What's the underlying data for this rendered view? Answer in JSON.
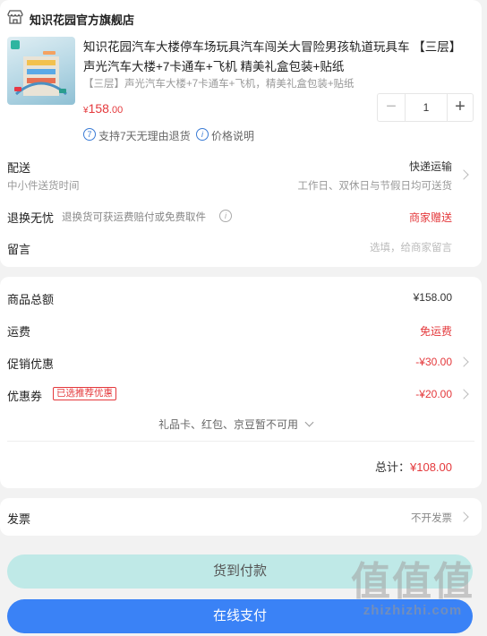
{
  "store": {
    "name": "知识花园官方旗舰店"
  },
  "product": {
    "title": "知识花园汽车大楼停车场玩具汽车闯关大冒险男孩轨道玩具车 【三层】声光汽车大楼+7卡通车+飞机 精美礼盒包装+贴纸",
    "sku": "【三层】声光汽车大楼+7卡通车+飞机，精美礼盒包装+贴纸",
    "price_symbol": "¥",
    "price_int": "158",
    "price_dec": ".00",
    "quantity": "1",
    "minus": "−",
    "plus": "+",
    "support_icon": "7",
    "support_text": "支持7天无理由退货",
    "info_icon": "i",
    "price_note": "价格说明"
  },
  "delivery": {
    "label": "配送",
    "sub": "中小件送货时间",
    "method": "快递运输",
    "time": "工作日、双休日与节假日均可送货"
  },
  "returns": {
    "label": "退换无忧",
    "desc": "退换货可获运费赔付或免费取件",
    "info_icon": "i",
    "value": "商家赠送"
  },
  "message": {
    "label": "留言",
    "placeholder": "选填，给商家留言"
  },
  "summary": {
    "goods_label": "商品总额",
    "goods_value": "¥158.00",
    "shipping_label": "运费",
    "shipping_value": "免运费",
    "promo_label": "促销优惠",
    "promo_value": "-¥30.00",
    "coupon_label": "优惠券",
    "coupon_tag": "已选推荐优惠",
    "coupon_value": "-¥20.00",
    "unavailable": "礼品卡、红包、京豆暂不可用",
    "total_label": "总计：",
    "total_value": "¥108.00"
  },
  "invoice": {
    "label": "发票",
    "value": "不开发票"
  },
  "buttons": {
    "cod": "货到付款",
    "online": "在线支付"
  },
  "watermark": {
    "big": "值值值",
    "small": "zhizhizhi.com"
  },
  "colors": {
    "price_red": "#e4393c",
    "pay_blue": "#3a82f6",
    "cod_teal": "#bfe9e7",
    "info_blue": "#3a7bd5"
  }
}
